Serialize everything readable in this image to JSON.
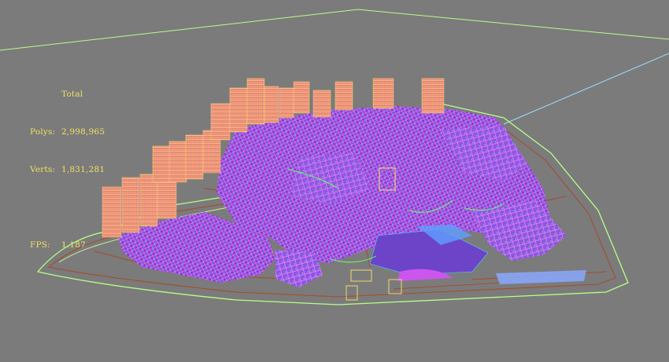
{
  "viewport": {
    "background_color": "#7b7b7b",
    "wire_colors": [
      "#ff77ff",
      "#b444ff",
      "#ffaa44",
      "#44ddff",
      "#66ff66",
      "#ffff66"
    ],
    "ground_line_color": "#b8ff88",
    "road_line_color": "#a64a2a"
  },
  "stats": {
    "total_label": "Total",
    "polys_label": "Polys:",
    "polys_value": "2,998,965",
    "verts_label": "Verts:",
    "verts_value": "1,831,281",
    "fps_label": "FPS:",
    "fps_value": "1.187",
    "text_color": "#f0e060"
  }
}
